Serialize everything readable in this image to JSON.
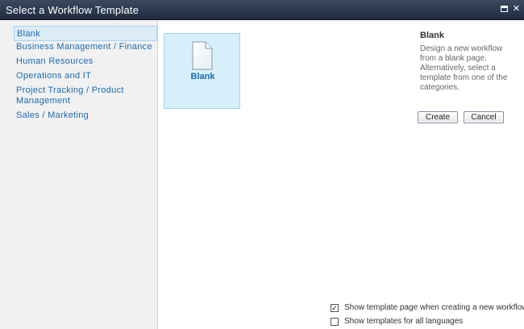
{
  "dialog": {
    "title": "Select a Workflow Template"
  },
  "titlebar_icons": {
    "maximize": "maximize-icon",
    "close": "close-icon"
  },
  "sidebar": {
    "items": [
      {
        "label": "Blank",
        "selected": true
      },
      {
        "label": "Business Management / Finance",
        "selected": false
      },
      {
        "label": "Human Resources",
        "selected": false
      },
      {
        "label": "Operations and IT",
        "selected": false
      },
      {
        "label": "Project Tracking / Product",
        "selected": false
      },
      {
        "label": "Management",
        "selected": false
      },
      {
        "label": "Sales / Marketing",
        "selected": false
      }
    ]
  },
  "templates": [
    {
      "label": "Blank",
      "icon": "document-icon",
      "selected": true
    }
  ],
  "details": {
    "title": "Blank",
    "description": "Design a new workflow from a blank page. Alternatively, select a template from one of the categories."
  },
  "buttons": {
    "create": "Create",
    "cancel": "Cancel"
  },
  "options": {
    "show_template_page": {
      "label": "Show template page when creating a new workflow",
      "checked": true,
      "mark": "✓"
    },
    "show_all_languages": {
      "label": "Show templates for all languages",
      "checked": false,
      "mark": ""
    }
  },
  "colors": {
    "accent": "#1b6bb1",
    "selection": "#dcedf8",
    "titlebar": "#2a384e"
  }
}
